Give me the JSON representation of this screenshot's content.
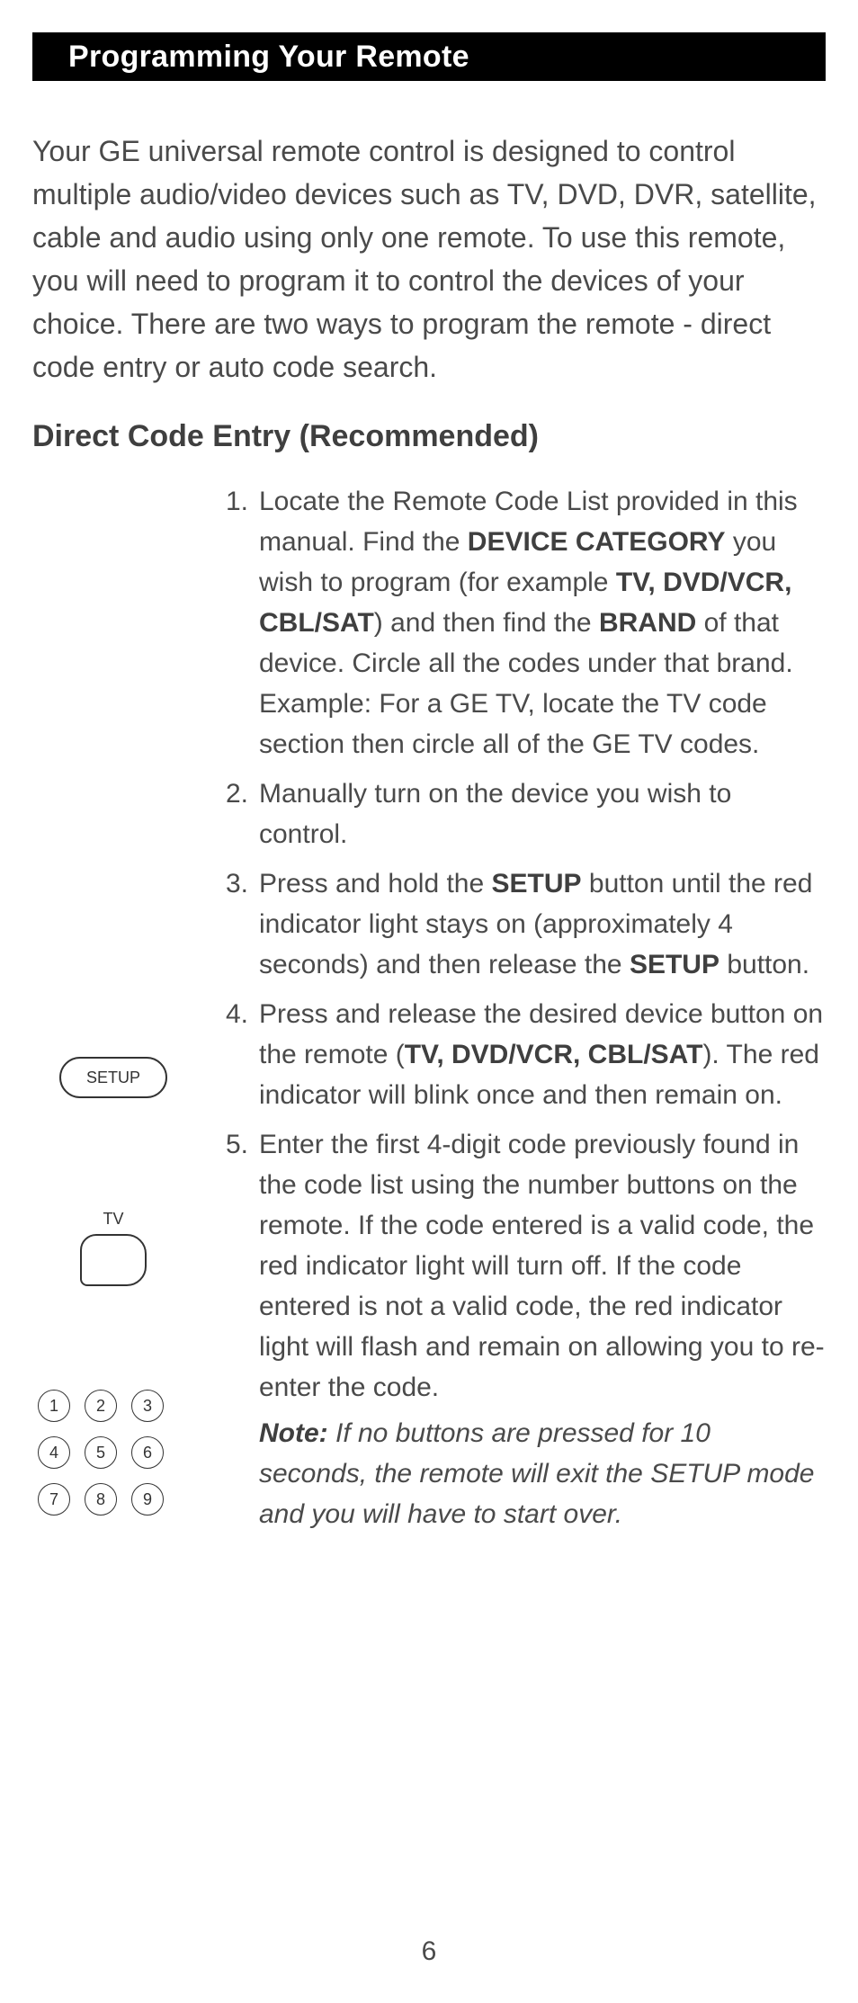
{
  "heading": "Programming Your Remote",
  "intro": "Your GE universal remote control is designed to control multiple audio/video devices such as TV, DVD, DVR, satellite, cable and audio using only one remote. To use this remote, you will need to program it to control the devices of your choice. There are two ways to program the remote - direct code entry or auto code search.",
  "section_title": "Direct Code Entry (Recommended)",
  "steps": {
    "s1": {
      "pre": "Locate the Remote Code List provided in this manual. Find the ",
      "b1": "DEVICE CATEGORY",
      "mid1": " you wish to program (for example ",
      "b2": "TV, DVD/VCR, CBL/SAT",
      "mid2": ") and then find the ",
      "b3": "BRAND",
      "post": " of that device. Circle all the codes under that brand. Example: For a GE TV, locate the TV code section then circle all of the GE TV codes."
    },
    "s2": "Manually turn on the device you wish to control.",
    "s3": {
      "pre": "Press and hold the ",
      "b1": "SETUP",
      "mid": " button until the red indicator light stays on (approximately 4 seconds) and then release the ",
      "b2": "SETUP",
      "post": " button."
    },
    "s4": {
      "pre": "Press and release the desired device button on the remote (",
      "b1": "TV, DVD/VCR, CBL/SAT",
      "post": "). The red indicator will blink once and then remain on."
    },
    "s5": "Enter the first 4-digit code previously found in the code list using the number buttons on the remote. If the code entered is a valid code, the red indicator light will turn off. If the code entered is not a valid code, the red indicator light will flash and remain on allowing you to re-enter the code.",
    "note_label": "Note:",
    "note_text": " If no buttons are pressed for 10 seconds, the remote will exit the SETUP mode and you will have to start over."
  },
  "illus": {
    "setup_label": "SETUP",
    "tv_label": "TV",
    "keys": [
      "1",
      "2",
      "3",
      "4",
      "5",
      "6",
      "7",
      "8",
      "9"
    ]
  },
  "page_number": "6"
}
